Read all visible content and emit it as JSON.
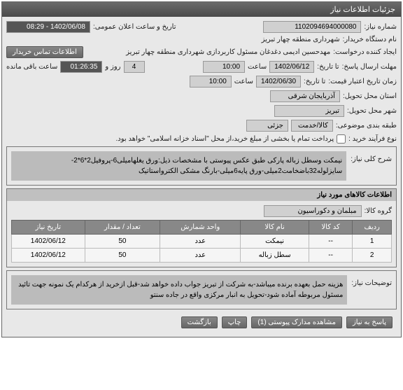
{
  "header": {
    "title": "جزئیات اطلاعات نیاز"
  },
  "form": {
    "need_number_label": "شماره نیاز:",
    "need_number": "1102094694000080",
    "announce_label": "تاریخ و ساعت اعلان عمومی:",
    "announce_value": "1402/06/08 - 08:29",
    "buyer_label": "نام دستگاه خریدار:",
    "buyer_value": "شهرداری منطقه چهار تبریز",
    "requester_label": "ایجاد کننده درخواست:",
    "requester_value": "مهدحسین ادیمی دغدغان مسئول کاربردازی شهرداری منطقه چهار تبریز",
    "contact_btn": "اطلاعات تماس خریدار",
    "send_deadline_label": "مهلت ارسال پاسخ:",
    "send_deadline_ta": "تا تاریخ:",
    "send_deadline_date": "1402/06/12",
    "send_deadline_time_label": "ساعت",
    "send_deadline_time": "10:00",
    "days_value": "4",
    "days_label": "روز و",
    "countdown": "01:26:35",
    "remaining_label": "ساعت باقی مانده",
    "price_valid_label": "زمان تاریخ اعتبار قیمت:",
    "price_valid_ta": "تا تاریخ:",
    "price_valid_date": "1402/06/30",
    "price_valid_time_label": "ساعت",
    "price_valid_time": "10:00",
    "province_label": "استان محل تحویل:",
    "province_value": "آذربایجان شرقی",
    "city_label": "شهر محل تحویل:",
    "city_value": "تبریز",
    "category_label": "طبقه بندی موضوعی:",
    "category_item": "کالا/خدمت",
    "category_detail": "جزئی",
    "process_label": "نوع فرآیند خرید :",
    "process_checkbox": "پرداخت تمام یا بخشی از مبلغ خرید،از محل \"اسناد خزانه اسلامی\" خواهد بود."
  },
  "need_desc": {
    "title": "شرح کلی نیاز:",
    "text": "نیمکت وسطل زباله پارکی طبق عکس پیوستی با مشخصات ذیل:ورق یغلهامیلی6-پروفیل2*6*2-سایزلوله32باضخامت2میلی-ورق پایه6میلی-بارنگ مشکی الکترواستاتیک"
  },
  "goods": {
    "title": "اطلاعات کالاهای مورد نیاز",
    "group_label": "گروه کالا:",
    "group_value": "مبلمان و دکوراسیون",
    "columns": {
      "row": "ردیف",
      "code": "کد کالا",
      "name": "نام کالا",
      "unit": "واحد شمارش",
      "qty": "تعداد / مقدار",
      "date": "تاریخ نیاز"
    },
    "rows": [
      {
        "row": "1",
        "code": "--",
        "name": "نیمکت",
        "unit": "عدد",
        "qty": "50",
        "date": "1402/06/12"
      },
      {
        "row": "2",
        "code": "--",
        "name": "سطل زباله",
        "unit": "عدد",
        "qty": "50",
        "date": "1402/06/12"
      }
    ]
  },
  "notes": {
    "title": "توضیحات نیاز:",
    "text": "هزینه حمل بعهده برنده میباشد-به شرکت از تبریز جواب داده خواهد شد-قبل ازخرید از هرکدام یک نمونه جهت تائید مسئول مربوطه آماده شود-تحویل به انبار مرکزی واقع در جاده سنتو"
  },
  "footer": {
    "reply": "پاسخ به نیاز",
    "attachments": "مشاهده مدارک پیوستی (1)",
    "print": "چاپ",
    "back": "بازگشت"
  }
}
